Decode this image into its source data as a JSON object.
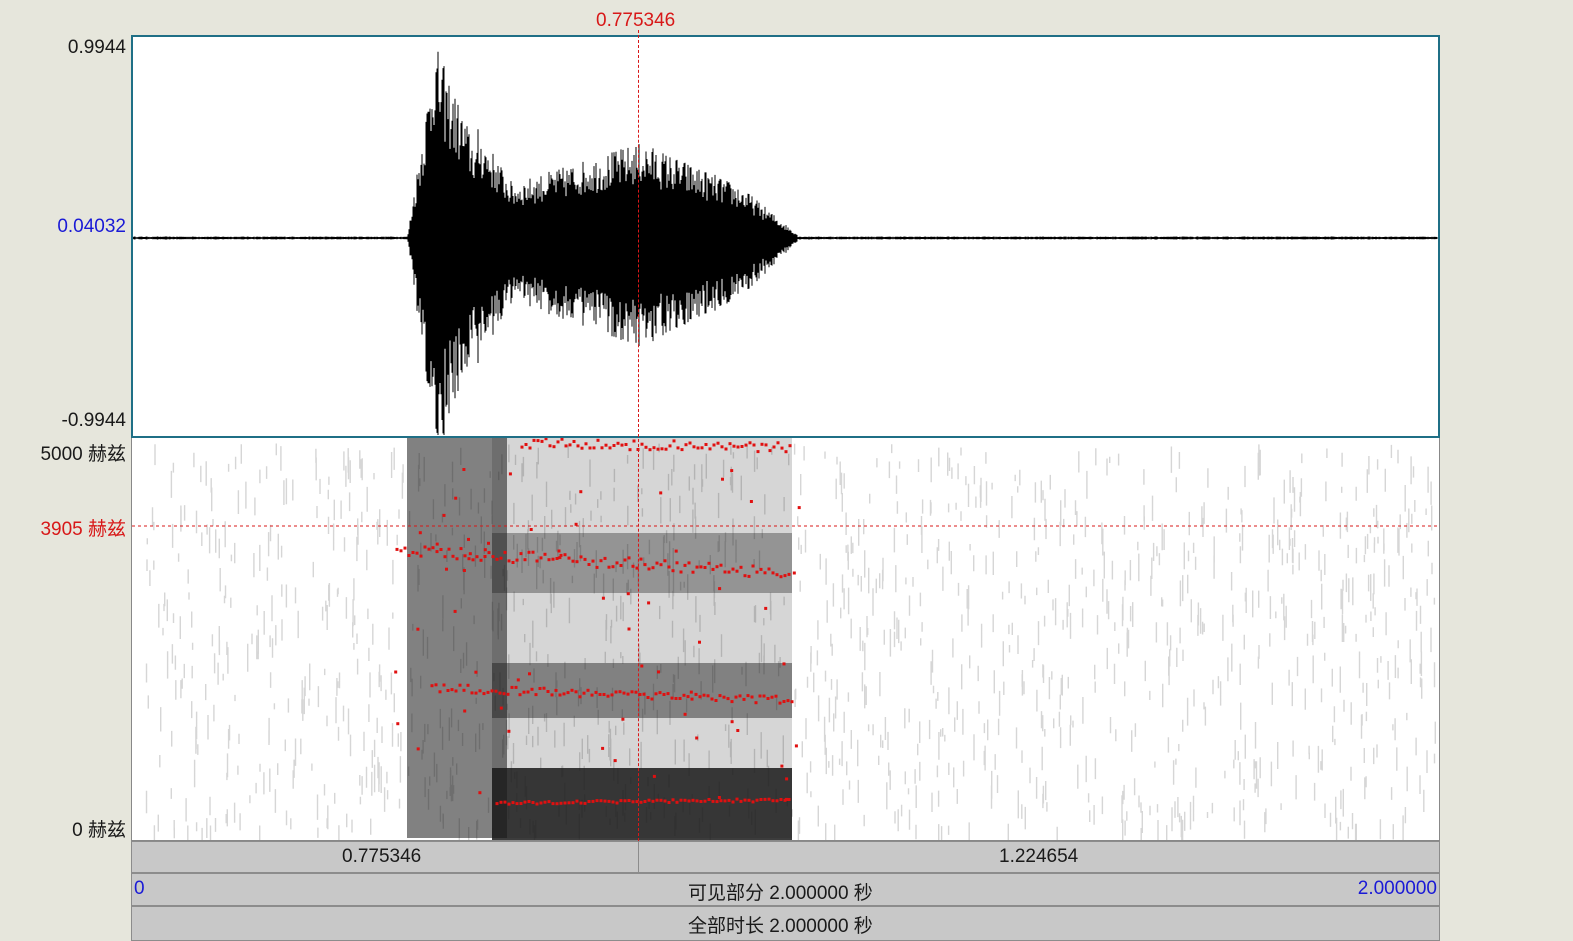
{
  "cursor": {
    "time_label": "0.775346"
  },
  "waveform": {
    "amp_max_label": "0.9944",
    "amp_cursor_label": "0.04032",
    "amp_min_label": "-0.9944"
  },
  "spectrogram": {
    "freq_max_label": "5000 赫兹",
    "freq_cursor_label": "3905 赫兹",
    "freq_min_label": "0 赫兹"
  },
  "time_bar": {
    "left_segment": "0.775346",
    "right_segment": "1.224654"
  },
  "visible_bar": {
    "start": "0",
    "label": "可见部分 2.000000 秒",
    "end": "2.000000"
  },
  "total_bar": {
    "label": "全部时长 2.000000 秒"
  },
  "colors": {
    "cursor": "#d81818",
    "formant": "#e01010",
    "blue_value": "#1a1ad6",
    "panel_border": "#1f6f86"
  }
}
